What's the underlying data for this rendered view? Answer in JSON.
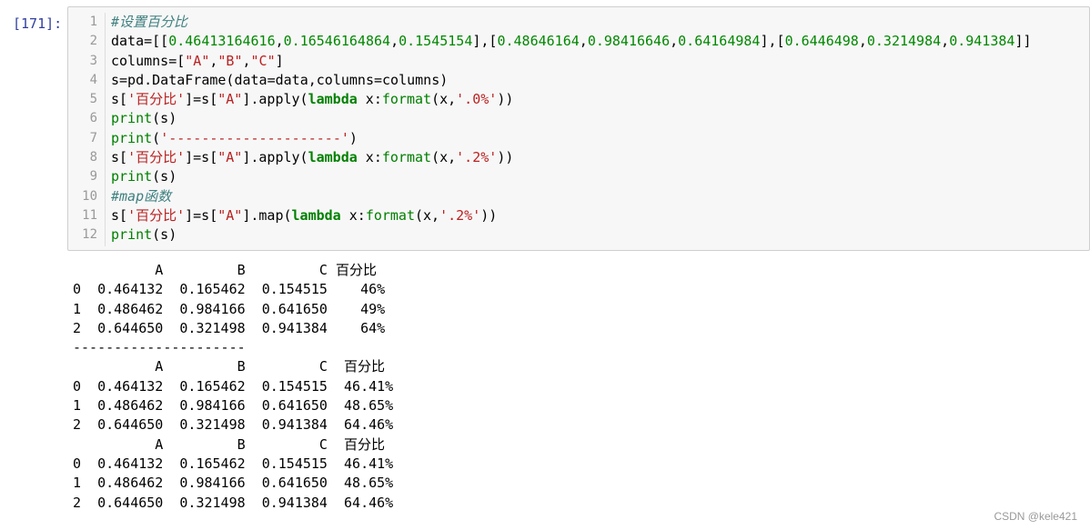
{
  "prompt": "[171]:",
  "code": {
    "line_numbers": [
      "1",
      "2",
      "3",
      "4",
      "5",
      "6",
      "7",
      "8",
      "9",
      "10",
      "11",
      "12"
    ],
    "lines": [
      [
        {
          "t": "#设置百分比",
          "c": "cm"
        }
      ],
      [
        {
          "t": "data=[[",
          "c": ""
        },
        {
          "t": "0.46413164616",
          "c": "num"
        },
        {
          "t": ",",
          "c": ""
        },
        {
          "t": "0.16546164864",
          "c": "num"
        },
        {
          "t": ",",
          "c": ""
        },
        {
          "t": "0.1545154",
          "c": "num"
        },
        {
          "t": "],[",
          "c": ""
        },
        {
          "t": "0.48646164",
          "c": "num"
        },
        {
          "t": ",",
          "c": ""
        },
        {
          "t": "0.98416646",
          "c": "num"
        },
        {
          "t": ",",
          "c": ""
        },
        {
          "t": "0.64164984",
          "c": "num"
        },
        {
          "t": "],[",
          "c": ""
        },
        {
          "t": "0.6446498",
          "c": "num"
        },
        {
          "t": ",",
          "c": ""
        },
        {
          "t": "0.3214984",
          "c": "num"
        },
        {
          "t": ",",
          "c": ""
        },
        {
          "t": "0.941384",
          "c": "num"
        },
        {
          "t": "]]",
          "c": ""
        }
      ],
      [
        {
          "t": "columns=[",
          "c": ""
        },
        {
          "t": "\"A\"",
          "c": "str"
        },
        {
          "t": ",",
          "c": ""
        },
        {
          "t": "\"B\"",
          "c": "str"
        },
        {
          "t": ",",
          "c": ""
        },
        {
          "t": "\"C\"",
          "c": "str"
        },
        {
          "t": "]",
          "c": ""
        }
      ],
      [
        {
          "t": "s=pd.DataFrame(data=data,columns=columns)",
          "c": ""
        }
      ],
      [
        {
          "t": "s[",
          "c": ""
        },
        {
          "t": "'百分比'",
          "c": "str"
        },
        {
          "t": "]=s[",
          "c": ""
        },
        {
          "t": "\"A\"",
          "c": "str"
        },
        {
          "t": "].apply(",
          "c": ""
        },
        {
          "t": "lambda",
          "c": "kw"
        },
        {
          "t": " x:",
          "c": ""
        },
        {
          "t": "format",
          "c": "bi"
        },
        {
          "t": "(x,",
          "c": ""
        },
        {
          "t": "'.0%'",
          "c": "str"
        },
        {
          "t": "))",
          "c": ""
        }
      ],
      [
        {
          "t": "print",
          "c": "bi"
        },
        {
          "t": "(s)",
          "c": ""
        }
      ],
      [
        {
          "t": "print",
          "c": "bi"
        },
        {
          "t": "(",
          "c": ""
        },
        {
          "t": "'---------------------'",
          "c": "str"
        },
        {
          "t": ")",
          "c": ""
        }
      ],
      [
        {
          "t": "s[",
          "c": ""
        },
        {
          "t": "'百分比'",
          "c": "str"
        },
        {
          "t": "]=s[",
          "c": ""
        },
        {
          "t": "\"A\"",
          "c": "str"
        },
        {
          "t": "].apply(",
          "c": ""
        },
        {
          "t": "lambda",
          "c": "kw"
        },
        {
          "t": " x:",
          "c": ""
        },
        {
          "t": "format",
          "c": "bi"
        },
        {
          "t": "(x,",
          "c": ""
        },
        {
          "t": "'.2%'",
          "c": "str"
        },
        {
          "t": "))",
          "c": ""
        }
      ],
      [
        {
          "t": "print",
          "c": "bi"
        },
        {
          "t": "(s)",
          "c": ""
        }
      ],
      [
        {
          "t": "#map函数",
          "c": "cm"
        }
      ],
      [
        {
          "t": "s[",
          "c": ""
        },
        {
          "t": "'百分比'",
          "c": "str"
        },
        {
          "t": "]=s[",
          "c": ""
        },
        {
          "t": "\"A\"",
          "c": "str"
        },
        {
          "t": "].map(",
          "c": ""
        },
        {
          "t": "lambda",
          "c": "kw"
        },
        {
          "t": " x:",
          "c": ""
        },
        {
          "t": "format",
          "c": "bi"
        },
        {
          "t": "(x,",
          "c": ""
        },
        {
          "t": "'.2%'",
          "c": "str"
        },
        {
          "t": "))",
          "c": ""
        }
      ],
      [
        {
          "t": "print",
          "c": "bi"
        },
        {
          "t": "(s)",
          "c": ""
        }
      ]
    ]
  },
  "output": [
    "          A         B         C 百分比",
    "0  0.464132  0.165462  0.154515    46%",
    "1  0.486462  0.984166  0.641650    49%",
    "2  0.644650  0.321498  0.941384    64%",
    "---------------------",
    "          A         B         C  百分比",
    "0  0.464132  0.165462  0.154515  46.41%",
    "1  0.486462  0.984166  0.641650  48.65%",
    "2  0.644650  0.321498  0.941384  64.46%",
    "          A         B         C  百分比",
    "0  0.464132  0.165462  0.154515  46.41%",
    "1  0.486462  0.984166  0.641650  48.65%",
    "2  0.644650  0.321498  0.941384  64.46%"
  ],
  "watermark": "CSDN @kele421"
}
